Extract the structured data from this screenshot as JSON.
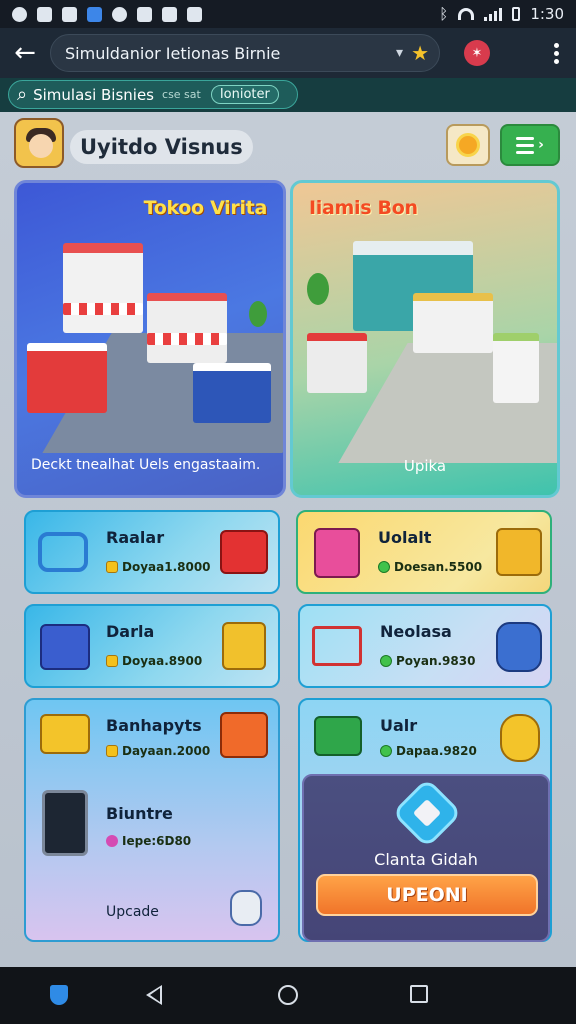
{
  "status_bar": {
    "time": "1:30"
  },
  "browser": {
    "url_text": "Simuldanior Ietionas Birnie"
  },
  "search_strip": {
    "label": "Simulasi Bisnies",
    "noise": "cse sat",
    "chip": "Ionioter"
  },
  "header": {
    "title": "Uyitdo Visnus"
  },
  "heroes": [
    {
      "title": "Tokoo Virita",
      "caption": "Deckt tnealhat Uels engastaaim."
    },
    {
      "title": "Iiamis Bon",
      "caption": "Upika"
    }
  ],
  "cards_left": [
    {
      "title": "Raalar",
      "price": "Doyaa1.8000",
      "currency": "coin"
    },
    {
      "title": "Darla",
      "price": "Doyaa.8900",
      "currency": "coin"
    },
    {
      "title": "Banhapyts",
      "price": "Dayaan.2000",
      "currency": "coin"
    },
    {
      "title": "Biuntre",
      "price": "Iepe:6D80",
      "currency": "heart"
    },
    {
      "title": "Upcade",
      "price": "",
      "currency": ""
    }
  ],
  "cards_right": [
    {
      "title": "Uolalt",
      "price": "Doesan.5500",
      "currency": "gem"
    },
    {
      "title": "Neolasa",
      "price": "Poyan.9830",
      "currency": "gem"
    },
    {
      "title": "Ualr",
      "price": "Dapaa.9820",
      "currency": "gem"
    }
  ],
  "upgrade_panel": {
    "label": "Clanta Gidah",
    "button": "UPEONI"
  },
  "colors": {
    "accent_orange": "#f0742a",
    "card_blue": "#39b7e8",
    "hero_blue": "#3d58d6",
    "hero_teal": "#3fc3ad"
  }
}
